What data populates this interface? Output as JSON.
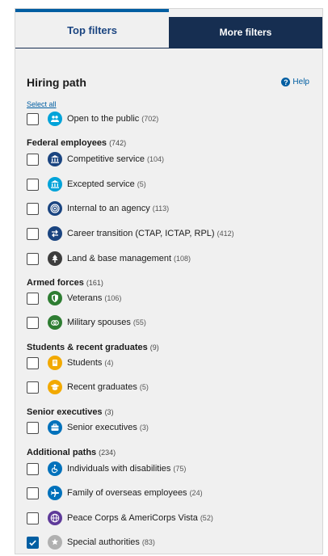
{
  "tabs": {
    "top": "Top filters",
    "more": "More filters"
  },
  "section": {
    "title": "Hiring path",
    "help": "Help",
    "select_all": "Select all"
  },
  "colors": {
    "tab_active_border": "#005ea2",
    "tab_inactive_bg": "#162e51",
    "public": "#00a3d9",
    "federal": "#1a4480",
    "excepted": "#00a3d9",
    "internal": "#1a4480",
    "career": "#1a4480",
    "land": "#3d3d3d",
    "military": "#2e7d32",
    "students": "#f2a900",
    "senior": "#0071bb",
    "disab": "#0071bb",
    "overseas": "#0071bb",
    "peace": "#5e3a99",
    "special": "#b0b0b0"
  },
  "items": {
    "public": {
      "label": "Open to the public",
      "count": "(702)",
      "icon": "people-icon",
      "checked": false
    },
    "competitive": {
      "label": "Competitive service",
      "count": "(104)",
      "icon": "building-icon",
      "checked": false
    },
    "excepted": {
      "label": "Excepted service",
      "count": "(5)",
      "icon": "building-icon",
      "checked": false
    },
    "internal": {
      "label": "Internal to an agency",
      "count": "(113)",
      "icon": "target-icon",
      "checked": false
    },
    "career": {
      "label": "Career transition (CTAP, ICTAP, RPL)",
      "count": "(412)",
      "icon": "swap-icon",
      "checked": false
    },
    "land": {
      "label": "Land & base management",
      "count": "(108)",
      "icon": "tree-icon",
      "checked": false
    },
    "veterans": {
      "label": "Veterans",
      "count": "(106)",
      "icon": "shield-icon",
      "checked": false
    },
    "military": {
      "label": "Military spouses",
      "count": "(55)",
      "icon": "rings-icon",
      "checked": false
    },
    "students": {
      "label": "Students",
      "count": "(4)",
      "icon": "book-icon",
      "checked": false
    },
    "recent": {
      "label": "Recent graduates",
      "count": "(5)",
      "icon": "graduation-cap-icon",
      "checked": false
    },
    "senior": {
      "label": "Senior executives",
      "count": "(3)",
      "icon": "briefcase-icon",
      "checked": false
    },
    "disabilities": {
      "label": "Individuals with disabilities",
      "count": "(75)",
      "icon": "accessibility-icon",
      "checked": false
    },
    "overseas": {
      "label": "Family of overseas employees",
      "count": "(24)",
      "icon": "plane-icon",
      "checked": false
    },
    "peace": {
      "label": "Peace Corps & AmeriCorps Vista",
      "count": "(52)",
      "icon": "globe-icon",
      "checked": false
    },
    "special": {
      "label": "Special authorities",
      "count": "(83)",
      "icon": "star-badge-icon",
      "checked": true
    }
  },
  "groups": {
    "federal": {
      "label": "Federal employees",
      "count": "(742)"
    },
    "armed": {
      "label": "Armed forces",
      "count": "(161)"
    },
    "students": {
      "label": "Students & recent graduates",
      "count": "(9)"
    },
    "senior": {
      "label": "Senior executives",
      "count": "(3)"
    },
    "additional": {
      "label": "Additional paths",
      "count": "(234)"
    }
  }
}
